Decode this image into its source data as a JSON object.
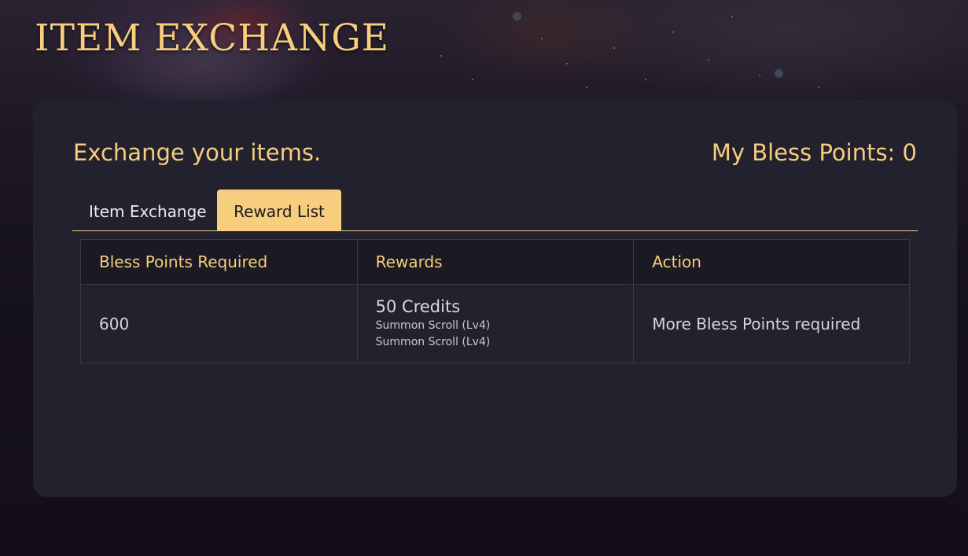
{
  "header": {
    "title": "ITEM EXCHANGE"
  },
  "panel": {
    "subtitle": "Exchange your items.",
    "bless_points_label": "My Bless Points: 0"
  },
  "tabs": [
    {
      "label": "Item Exchange",
      "active": false
    },
    {
      "label": "Reward List",
      "active": true
    }
  ],
  "table": {
    "columns": [
      "Bless Points Required",
      "Rewards",
      "Action"
    ],
    "rows": [
      {
        "points": "600",
        "reward_main": "50 Credits",
        "reward_items": [
          "Summon Scroll (Lv4)",
          "Summon Scroll (Lv4)"
        ],
        "action": "More Bless Points required"
      }
    ]
  },
  "colors": {
    "accent": "#f7cd7e",
    "panel": "#22212d",
    "header_row": "#1b1a23",
    "text": "#d6d4e0"
  }
}
